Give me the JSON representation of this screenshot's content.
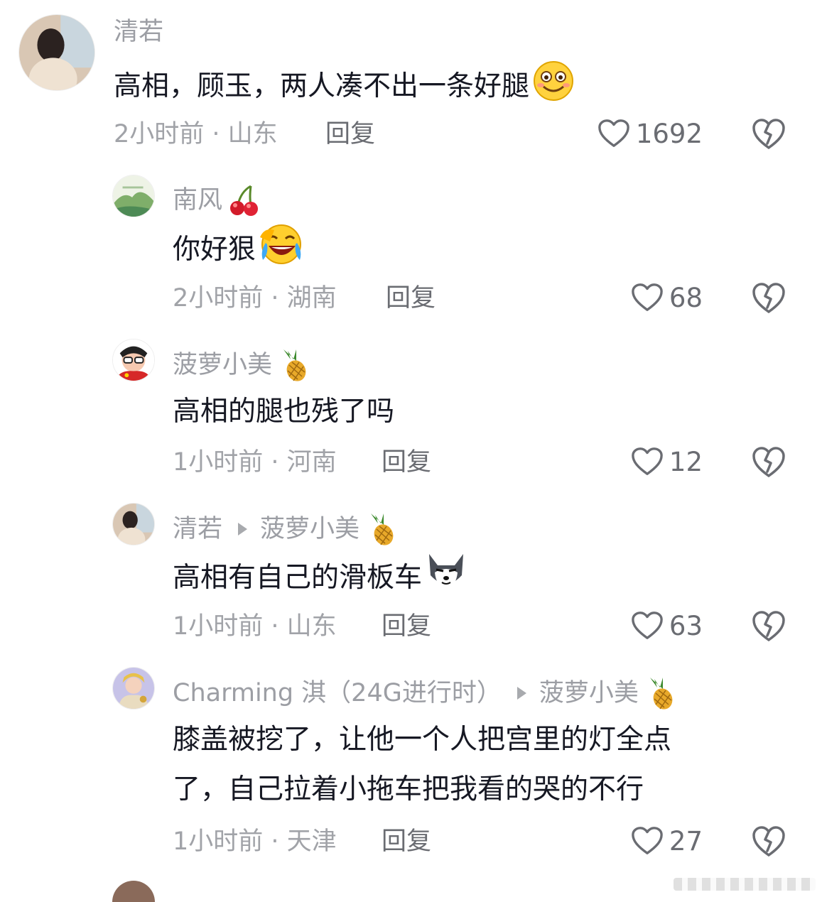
{
  "comments": [
    {
      "user": "清若",
      "text": "高相，顾玉，两人凑不出一条好腿",
      "meta": "2小时前 · 山东",
      "reply_label": "回复",
      "likes": "1692",
      "text_emoji": "grin-emoji"
    },
    {
      "user": "南风",
      "user_emoji": "cherry-emoji",
      "text": "你好狠",
      "meta": "2小时前 · 湖南",
      "reply_label": "回复",
      "likes": "68",
      "text_emoji": "laugh-cry-emoji"
    },
    {
      "user": "菠萝小美",
      "user_emoji": "pineapple-emoji",
      "text": "高相的腿也残了吗",
      "meta": "1小时前 · 河南",
      "reply_label": "回复",
      "likes": "12"
    },
    {
      "user": "清若",
      "reply_to": "菠萝小美",
      "reply_to_emoji": "pineapple-emoji",
      "text": "高相有自己的滑板车",
      "meta": "1小时前 · 山东",
      "reply_label": "回复",
      "likes": "63",
      "text_emoji": "husky-emoji"
    },
    {
      "user": "Charming 淇（24G进行时）",
      "reply_to": "菠萝小美",
      "reply_to_emoji": "pineapple-emoji",
      "text_line1": "膝盖被挖了，让他一个人把宫里的灯全点",
      "text_line2": "了，自己拉着小拖车把我看的哭的不行",
      "meta": "1小时前 · 天津",
      "reply_label": "回复",
      "likes": "27"
    }
  ],
  "colors": {
    "username": "#9c9ea4",
    "body_text": "#161823",
    "meta": "#a1a3a8",
    "icon": "#6a6c72"
  }
}
